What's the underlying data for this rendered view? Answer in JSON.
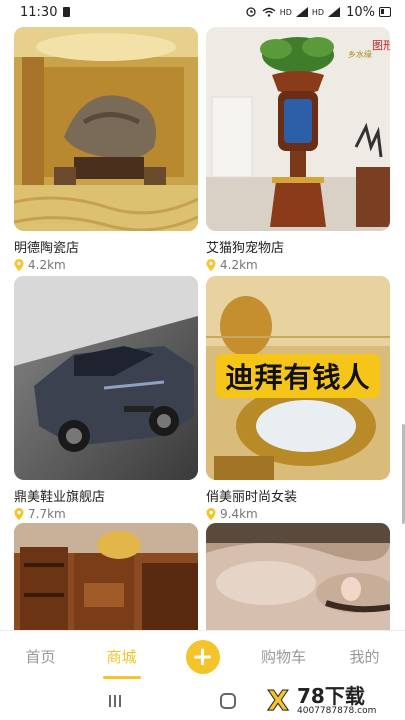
{
  "status": {
    "time": "11:30",
    "battery": "10%",
    "net1": "HD",
    "net2": "HD"
  },
  "shops": [
    {
      "name": "明德陶瓷店",
      "distance": "4.2km",
      "banner": ""
    },
    {
      "name": "艾猫狗宠物店",
      "distance": "4.2km",
      "banner": ""
    },
    {
      "name": "鼎美鞋业旗舰店",
      "distance": "7.7km",
      "banner": ""
    },
    {
      "name": "俏美丽时尚女装",
      "distance": "9.4km",
      "banner": "迪拜有钱人"
    },
    {
      "name": "",
      "distance": ""
    },
    {
      "name": "",
      "distance": ""
    }
  ],
  "image_text": {
    "top_right_caption": "图形形鱼缸",
    "top_right_small": "乡水缘"
  },
  "tabs": [
    {
      "label": "首页"
    },
    {
      "label": "商城"
    },
    {
      "label": ""
    },
    {
      "label": "购物车"
    },
    {
      "label": "我的"
    }
  ],
  "watermark": {
    "title": "78下载",
    "url": "4007787878.com"
  },
  "colors": {
    "accent": "#f5c32a",
    "inactive": "#999999"
  }
}
